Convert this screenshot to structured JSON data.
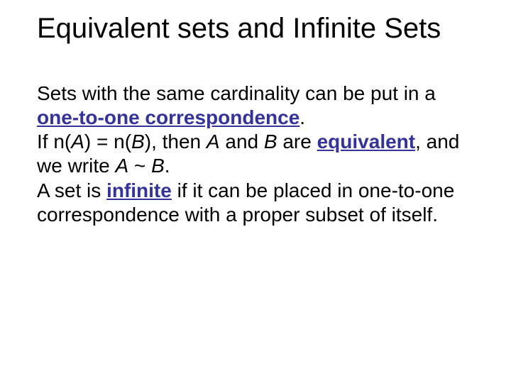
{
  "title": "Equivalent sets and Infinite Sets",
  "p1a": "Sets with the same cardinality can be put in a ",
  "term1": "one-to-one correspondence",
  "p1b": ".",
  "p2a": "If n(",
  "p2_A1": "A",
  "p2b": ") = n(",
  "p2_B1": "B",
  "p2c": "), then ",
  "p2_A2": "A",
  "p2d": " and ",
  "p2_B2": "B",
  "p2e": " are ",
  "term2": "equivalent",
  "p2f": ", and we write ",
  "p2_A3": "A",
  "p2g": " ~ ",
  "p2_B3": "B",
  "p2h": ".",
  "p3a": "A set is ",
  "term3": "infinite",
  "p3b": " if it can be placed in one-to-one correspondence with a proper subset of itself."
}
